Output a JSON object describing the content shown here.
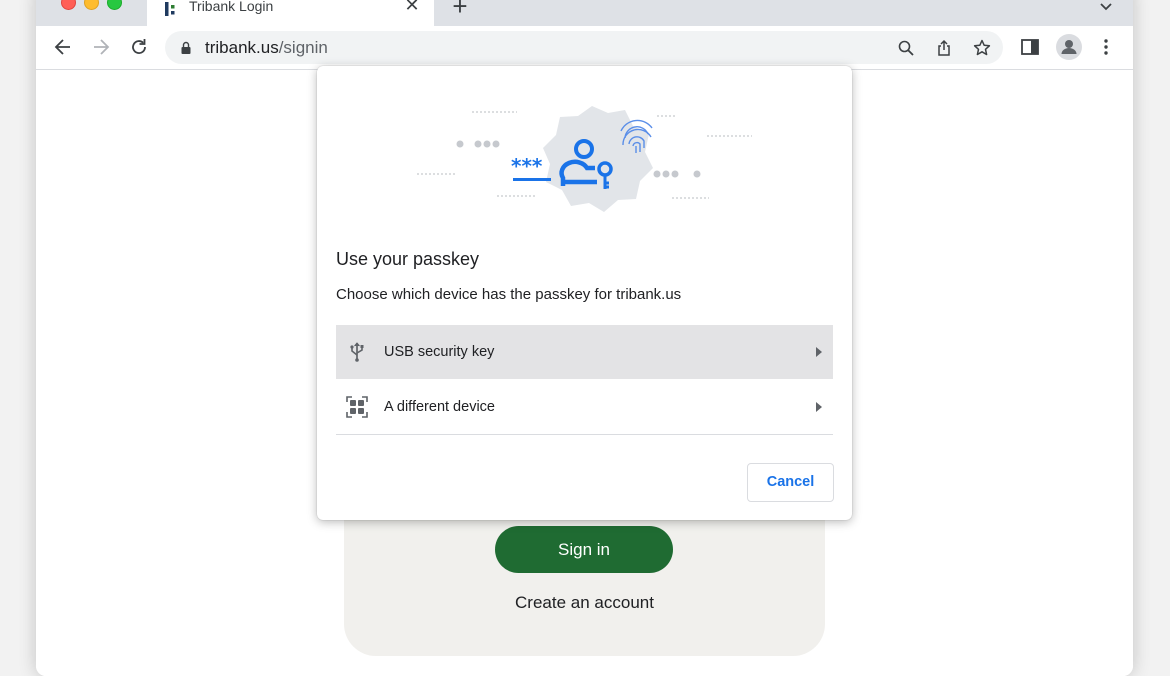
{
  "browser": {
    "tab_title": "Tribank Login",
    "tab_close": "✕",
    "new_tab": "+",
    "url_domain": "tribank.us",
    "url_path": "/signin"
  },
  "page": {
    "sign_in_label": "Sign in",
    "create_account_label": "Create an account"
  },
  "dialog": {
    "title": "Use your passkey",
    "subtitle": "Choose which device has the passkey for tribank.us",
    "options": [
      {
        "label": "USB security key",
        "icon": "usb-icon"
      },
      {
        "label": "A different device",
        "icon": "qr-code-icon"
      }
    ],
    "cancel_label": "Cancel"
  },
  "colors": {
    "sign_in_green": "#1f6b32",
    "accent_blue": "#1a73e8",
    "card_background": "#f1f0ed"
  }
}
